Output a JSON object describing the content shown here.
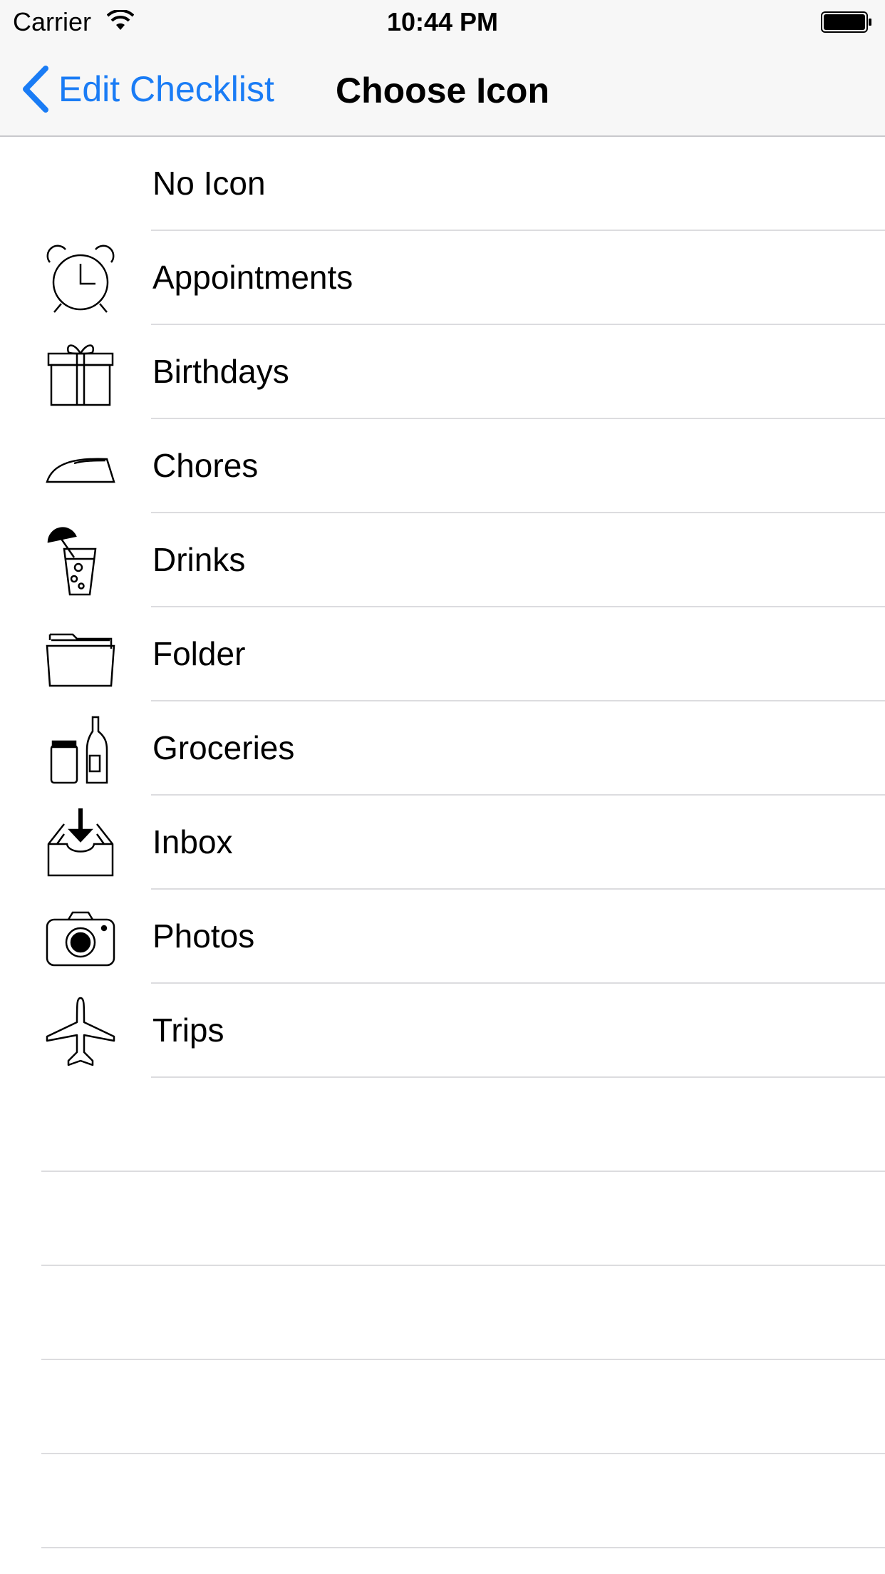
{
  "status_bar": {
    "carrier": "Carrier",
    "time": "10:44 PM"
  },
  "nav": {
    "back_label": "Edit Checklist",
    "title": "Choose Icon"
  },
  "colors": {
    "accent": "#1a7cf5",
    "bar_background": "#f7f7f7",
    "separator": "#dcdcdf"
  },
  "icons": [
    {
      "label": "No Icon",
      "icon": "none"
    },
    {
      "label": "Appointments",
      "icon": "alarm-clock-icon"
    },
    {
      "label": "Birthdays",
      "icon": "gift-icon"
    },
    {
      "label": "Chores",
      "icon": "iron-icon"
    },
    {
      "label": "Drinks",
      "icon": "drink-icon"
    },
    {
      "label": "Folder",
      "icon": "folder-icon"
    },
    {
      "label": "Groceries",
      "icon": "groceries-icon"
    },
    {
      "label": "Inbox",
      "icon": "inbox-icon"
    },
    {
      "label": "Photos",
      "icon": "camera-icon"
    },
    {
      "label": "Trips",
      "icon": "airplane-icon"
    }
  ]
}
